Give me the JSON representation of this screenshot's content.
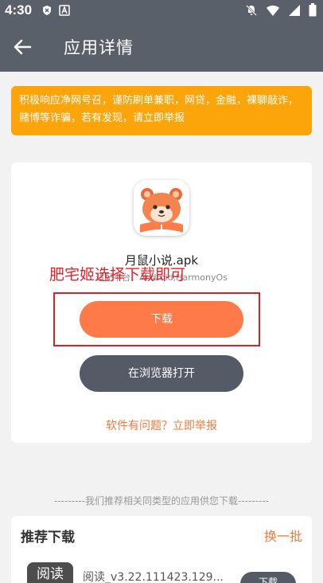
{
  "status_bar": {
    "time": "4:30"
  },
  "header": {
    "title": "应用详情"
  },
  "notice": {
    "text": "积极响应净网号召，谨防刷单兼职，网贷，金融，裸聊敲诈，赌博等诈骗，若有发现，请立即举报"
  },
  "app": {
    "name": "月鼠小说.apk",
    "meta": "适配平台：Android,HarmonyOs"
  },
  "overlay": {
    "text": "肥宅姬选择下载即可"
  },
  "buttons": {
    "download": "下载",
    "open_in_browser": "在浏览器打开"
  },
  "report": {
    "label": "软件有问题？立即举报"
  },
  "recommend": {
    "divider_text": "---------我们推荐相关同类型的应用供您下载---------",
    "title": "推荐下载",
    "refresh_label": "换一批",
    "items": [
      {
        "icon_text": "阅读",
        "name": "阅读_v3.22.111423.129...",
        "button": "下载"
      }
    ]
  },
  "colors": {
    "header_bg": "#5a6069",
    "notice_bg": "#fca50a",
    "download_btn": "#ff7a49",
    "browser_btn": "#545a66",
    "accent_text": "#f07a3c",
    "overlay_red": "#e8212b"
  }
}
